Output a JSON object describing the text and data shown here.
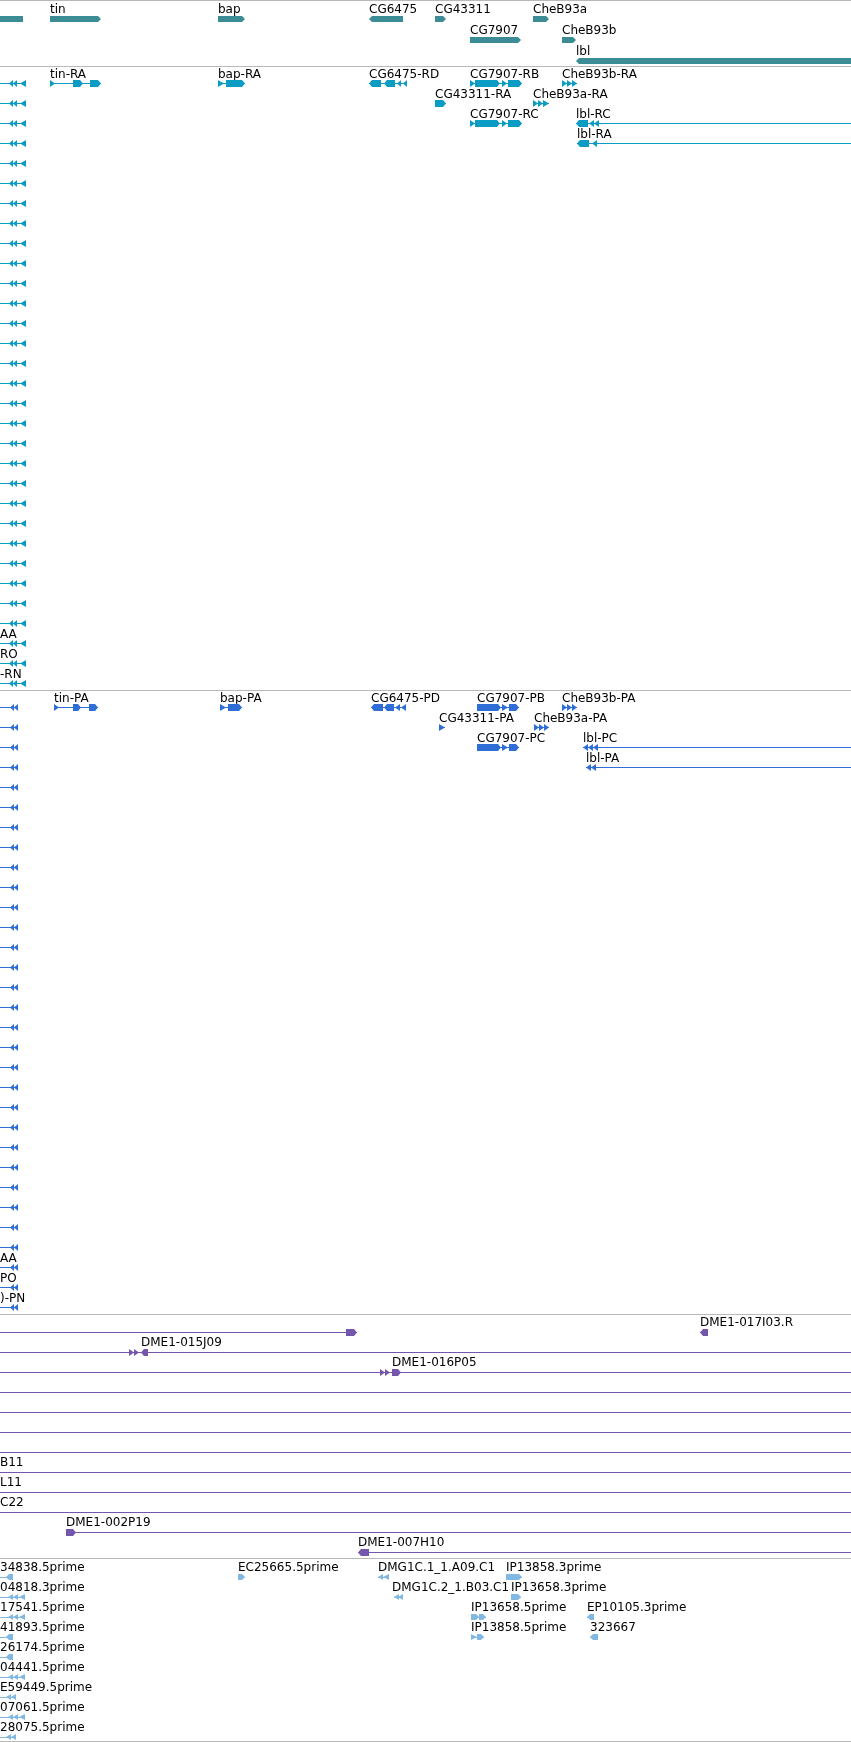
{
  "tracks": [
    {
      "kind": "gene",
      "rows": [
        {
          "features": [
            {
              "reverse": true
            },
            {
              "label": "tin",
              "reverse": false
            },
            {
              "label": "bap",
              "reverse": false
            },
            {
              "label": "CG6475",
              "reverse": true
            },
            {
              "label": "CG43311",
              "reverse": false
            },
            {
              "label": "CheB93a",
              "reverse": false
            }
          ]
        },
        {
          "features": [
            {
              "label": "CG7907",
              "reverse": false
            },
            {
              "label": "CheB93b",
              "reverse": false
            }
          ]
        },
        {
          "features": [
            {
              "label": "lbl",
              "reverse": true
            }
          ]
        }
      ]
    },
    {
      "kind": "transcript",
      "rows": [
        {
          "features": [
            {
              "reverse": true
            },
            {
              "label": "tin-RA",
              "reverse": false
            },
            {
              "label": "bap-RA",
              "reverse": false
            },
            {
              "label": "CG6475-RD",
              "reverse": true
            },
            {
              "label": "CG7907-RB",
              "reverse": false
            },
            {
              "label": "CheB93b-RA",
              "reverse": false
            }
          ]
        },
        {
          "features": [
            {
              "reverse": true
            },
            {
              "label": "CG43311-RA",
              "reverse": false
            },
            {
              "label": "CheB93a-RA",
              "reverse": false
            }
          ]
        },
        {
          "features": [
            {
              "reverse": true
            },
            {
              "label": "CG7907-RC",
              "reverse": false
            },
            {
              "label": "lbl-RC",
              "reverse": true
            }
          ]
        },
        {
          "features": [
            {
              "reverse": true
            },
            {
              "label": "lbl-RA",
              "reverse": true
            }
          ]
        },
        {
          "features": [
            {
              "reverse": true
            }
          ]
        },
        {
          "features": [
            {
              "reverse": true
            }
          ]
        },
        {
          "features": [
            {
              "reverse": true
            }
          ]
        },
        {
          "features": [
            {
              "reverse": true
            }
          ]
        },
        {
          "features": [
            {
              "reverse": true
            }
          ]
        },
        {
          "features": [
            {
              "reverse": true
            }
          ]
        },
        {
          "features": [
            {
              "reverse": true
            }
          ]
        },
        {
          "features": [
            {
              "reverse": true
            }
          ]
        },
        {
          "features": [
            {
              "reverse": true
            }
          ]
        },
        {
          "features": [
            {
              "reverse": true
            }
          ]
        },
        {
          "features": [
            {
              "reverse": true
            }
          ]
        },
        {
          "features": [
            {
              "reverse": true
            }
          ]
        },
        {
          "features": [
            {
              "reverse": true
            }
          ]
        },
        {
          "features": [
            {
              "reverse": true
            }
          ]
        },
        {
          "features": [
            {
              "reverse": true
            }
          ]
        },
        {
          "features": [
            {
              "reverse": true
            }
          ]
        },
        {
          "features": [
            {
              "reverse": true
            }
          ]
        },
        {
          "features": [
            {
              "reverse": true
            }
          ]
        },
        {
          "features": [
            {
              "reverse": true
            }
          ]
        },
        {
          "features": [
            {
              "reverse": true
            }
          ]
        },
        {
          "features": [
            {
              "reverse": true
            }
          ]
        },
        {
          "features": [
            {
              "reverse": true
            }
          ]
        },
        {
          "features": [
            {
              "reverse": true
            }
          ]
        },
        {
          "features": [
            {
              "reverse": true
            }
          ]
        },
        {
          "features": [
            {
              "label": "AA",
              "reverse": true
            }
          ]
        },
        {
          "features": [
            {
              "label": "RO",
              "reverse": true
            }
          ]
        },
        {
          "features": [
            {
              "label": "-RN",
              "reverse": true
            }
          ]
        }
      ]
    },
    {
      "kind": "protein",
      "rows": [
        {
          "features": [
            {
              "reverse": true
            },
            {
              "label": "tin-PA",
              "reverse": false
            },
            {
              "label": "bap-PA",
              "reverse": false
            },
            {
              "label": "CG6475-PD",
              "reverse": true
            },
            {
              "label": "CG7907-PB",
              "reverse": false
            },
            {
              "label": "CheB93b-PA",
              "reverse": false
            }
          ]
        },
        {
          "features": [
            {
              "reverse": true
            },
            {
              "label": "CG43311-PA",
              "reverse": false
            },
            {
              "label": "CheB93a-PA",
              "reverse": false
            }
          ]
        },
        {
          "features": [
            {
              "reverse": true
            },
            {
              "label": "CG7907-PC",
              "reverse": false
            },
            {
              "label": "lbl-PC",
              "reverse": true
            }
          ]
        },
        {
          "features": [
            {
              "reverse": true
            },
            {
              "label": "lbl-PA",
              "reverse": true
            }
          ]
        },
        {
          "features": [
            {
              "reverse": true
            }
          ]
        },
        {
          "features": [
            {
              "reverse": true
            }
          ]
        },
        {
          "features": [
            {
              "reverse": true
            }
          ]
        },
        {
          "features": [
            {
              "reverse": true
            }
          ]
        },
        {
          "features": [
            {
              "reverse": true
            }
          ]
        },
        {
          "features": [
            {
              "reverse": true
            }
          ]
        },
        {
          "features": [
            {
              "reverse": true
            }
          ]
        },
        {
          "features": [
            {
              "reverse": true
            }
          ]
        },
        {
          "features": [
            {
              "reverse": true
            }
          ]
        },
        {
          "features": [
            {
              "reverse": true
            }
          ]
        },
        {
          "features": [
            {
              "reverse": true
            }
          ]
        },
        {
          "features": [
            {
              "reverse": true
            }
          ]
        },
        {
          "features": [
            {
              "reverse": true
            }
          ]
        },
        {
          "features": [
            {
              "reverse": true
            }
          ]
        },
        {
          "features": [
            {
              "reverse": true
            }
          ]
        },
        {
          "features": [
            {
              "reverse": true
            }
          ]
        },
        {
          "features": [
            {
              "reverse": true
            }
          ]
        },
        {
          "features": [
            {
              "reverse": true
            }
          ]
        },
        {
          "features": [
            {
              "reverse": true
            }
          ]
        },
        {
          "features": [
            {
              "reverse": true
            }
          ]
        },
        {
          "features": [
            {
              "reverse": true
            }
          ]
        },
        {
          "features": [
            {
              "reverse": true
            }
          ]
        },
        {
          "features": [
            {
              "reverse": true
            }
          ]
        },
        {
          "features": [
            {
              "reverse": true
            }
          ]
        },
        {
          "features": [
            {
              "label": "AA",
              "reverse": true
            }
          ]
        },
        {
          "features": [
            {
              "label": "PO",
              "reverse": true
            }
          ]
        },
        {
          "features": [
            {
              "label": ")-PN",
              "reverse": true
            }
          ]
        }
      ]
    },
    {
      "kind": "clone",
      "rows": [
        {
          "features": [
            {
              "kind": "clone",
              "reverse": false
            },
            {
              "kind": "clone",
              "label": "DME1-017I03.R",
              "reverse": true
            }
          ]
        },
        {
          "features": [
            {
              "kind": "clone",
              "label": "DME1-015J09",
              "reverse": false
            }
          ]
        },
        {
          "features": [
            {
              "kind": "clone",
              "label": "DME1-016P05",
              "reverse": false
            }
          ]
        },
        {
          "features": [
            {
              "kind": "line"
            }
          ]
        },
        {
          "features": [
            {
              "kind": "line"
            }
          ]
        },
        {
          "features": [
            {
              "kind": "line"
            }
          ]
        },
        {
          "features": [
            {
              "kind": "line"
            }
          ]
        },
        {
          "features": [
            {
              "kind": "line",
              "label": "B11"
            }
          ]
        },
        {
          "features": [
            {
              "kind": "line",
              "label": "L11"
            }
          ]
        },
        {
          "features": [
            {
              "kind": "line",
              "label": "C22"
            }
          ]
        },
        {
          "features": [
            {
              "kind": "clone",
              "label": "DME1-002P19",
              "reverse": false
            }
          ]
        },
        {
          "features": [
            {
              "kind": "clone",
              "label": "DME1-007H10",
              "reverse": true
            }
          ]
        }
      ]
    },
    {
      "kind": "est",
      "rows": [
        {
          "features": [
            {
              "label": "34838.5prime",
              "reverse": true
            },
            {
              "label": "EC25665.5prime",
              "reverse": false
            },
            {
              "label": "DMG1C.1_1.A09.C1",
              "reverse": true
            },
            {
              "label": "IP13858.3prime",
              "reverse": false
            }
          ]
        },
        {
          "features": [
            {
              "label": "04818.3prime",
              "reverse": true
            },
            {
              "label": "DMG1C.2_1.B03.C1",
              "reverse": true
            },
            {
              "label": "IP13658.3prime",
              "reverse": false
            }
          ]
        },
        {
          "features": [
            {
              "label": "17541.5prime",
              "reverse": true
            },
            {
              "label": "IP13658.5prime",
              "reverse": false
            },
            {
              "label": "EP10105.3prime",
              "reverse": true
            }
          ]
        },
        {
          "features": [
            {
              "label": "41893.5prime",
              "reverse": true
            },
            {
              "label": "IP13858.5prime",
              "reverse": false
            },
            {
              "label": "323667",
              "reverse": true
            }
          ]
        },
        {
          "features": [
            {
              "label": "26174.5prime",
              "reverse": true
            }
          ]
        },
        {
          "features": [
            {
              "label": "04441.5prime",
              "reverse": true
            }
          ]
        },
        {
          "features": [
            {
              "label": "E59449.5prime",
              "reverse": true
            }
          ]
        },
        {
          "features": [
            {
              "label": "07061.5prime",
              "reverse": true
            }
          ]
        },
        {
          "features": [
            {
              "label": "28075.5prime",
              "reverse": true
            }
          ]
        }
      ]
    }
  ]
}
